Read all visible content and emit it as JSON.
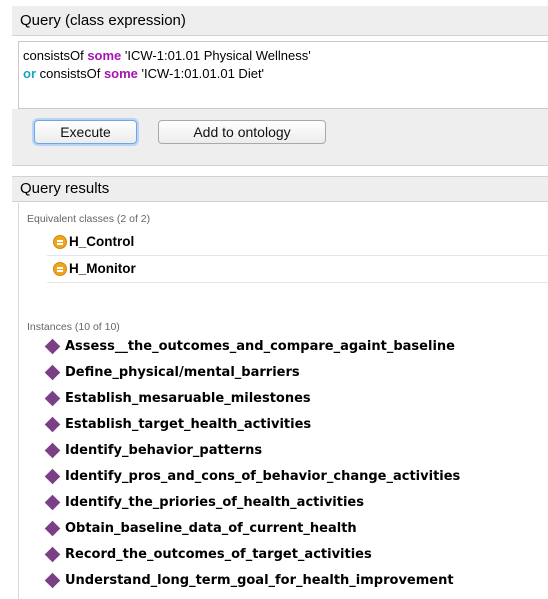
{
  "query_panel": {
    "title": "Query (class expression)",
    "line1": {
      "prop": "consistsOf",
      "kw": "some",
      "value": "'ICW-1:01.01 Physical Wellness'"
    },
    "line2": {
      "or": "or",
      "prop": "consistsOf",
      "kw": "some",
      "value": "'ICW-1:01.01.01 Diet'"
    },
    "execute_label": "Execute",
    "add_label": "Add to ontology"
  },
  "results_panel": {
    "title": "Query results",
    "equivalent_label": "Equivalent classes (2 of 2)",
    "equivalent_classes": [
      "H_Control",
      "H_Monitor"
    ],
    "instances_label": "Instances (10 of 10)",
    "instances": [
      "Assess__the_outcomes_and_compare_againt_baseline",
      "Define_physical/mental_barriers",
      "Establish_mesaruable_milestones",
      "Establish_target_health_activities",
      "Identify_behavior_patterns",
      "Identify_pros_and_cons_of_behavior_change_activities",
      "Identify_the_priories_of_health_activities",
      "Obtain_baseline_data_of_current_health",
      "Record_the_outcomes_of_target_activities",
      "Understand_long_term_goal_for_health_improvement"
    ]
  },
  "colors": {
    "keyword_some": "#a614b0",
    "keyword_or": "#1aa6b7",
    "class_icon": "#f0a51d",
    "instance_icon": "#7b3f86"
  },
  "icons": {
    "class": "equivalent-class-icon",
    "instance": "individual-diamond-icon"
  }
}
